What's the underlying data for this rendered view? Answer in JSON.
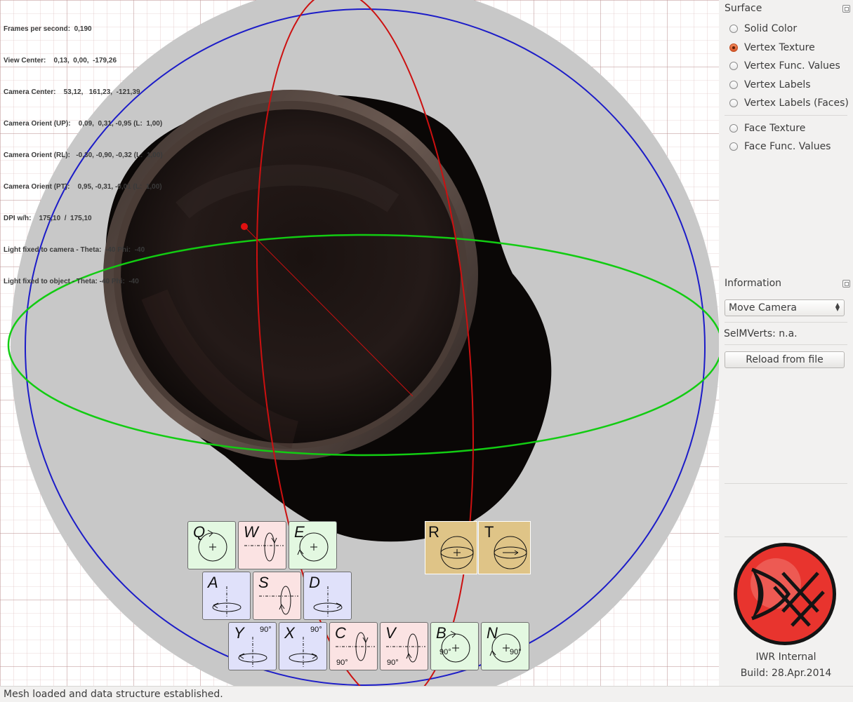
{
  "hud": {
    "lines": [
      "Frames per second:  0,190",
      "View Center:    0,13,  0,00,  -179,26",
      "Camera Center:    53,12,   161,23,  -121,39",
      "Camera Orient (UP):    0,09,  0,31, -0,95 (L:  1,00)",
      "Camera Orient (RL):   -0,30, -0,90, -0,32 (L:  1,00)",
      "Camera Orient (PT):    0,95, -0,31, -0,01 (L:  1,00)",
      "DPI w/h:    175,10  /  175,10",
      "Light fixed to camera - Theta:  -40 Phi:  -40",
      "Light fixed to object - Theta: -40 Phi:  -40"
    ]
  },
  "keys": {
    "Q": "Q",
    "W": "W",
    "E": "E",
    "R": "R",
    "T": "T",
    "A": "A",
    "S": "S",
    "D": "D",
    "Y": "Y",
    "X": "X",
    "C": "C",
    "V": "V",
    "B": "B",
    "N": "N",
    "deg": "90°"
  },
  "sidebar": {
    "surface_title": "Surface",
    "surface_options": [
      {
        "label": "Solid Color",
        "checked": false
      },
      {
        "label": "Vertex Texture",
        "checked": true
      },
      {
        "label": "Vertex Func. Values",
        "checked": false
      },
      {
        "label": "Vertex Labels",
        "checked": false
      },
      {
        "label": "Vertex Labels (Faces)",
        "checked": false
      },
      {
        "label": "Face Texture",
        "checked": false
      },
      {
        "label": "Face Func. Values",
        "checked": false
      }
    ],
    "information_title": "Information",
    "mode_select": "Move Camera",
    "selmverts": "SelMVerts: n.a.",
    "reload_button": "Reload from file",
    "brand_name": "IWR Internal",
    "build": "Build: 28.Apr.2014"
  },
  "status": "Mesh loaded and data structure established.",
  "colors": {
    "accent": "#d8572a",
    "grid": "#c99a9a",
    "sphere": "#c8c8c8",
    "ring_blue": "#1c1cc8",
    "ring_red": "#cc1010",
    "ring_green": "#12cc12",
    "logo_red": "#e8342e"
  }
}
